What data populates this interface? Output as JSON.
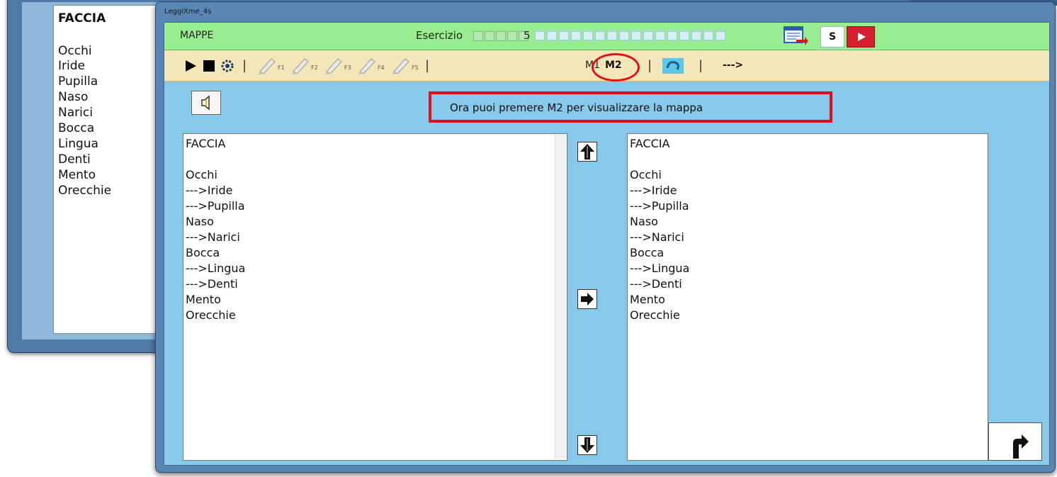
{
  "background_window": {
    "list": [
      "FACCIA",
      "",
      "Occhi",
      "Iride",
      "Pupilla",
      "Naso",
      "Narici",
      "Bocca",
      "Lingua",
      "Denti",
      "Mento",
      "Orecchie"
    ]
  },
  "window": {
    "title": "LeggiXme_4s",
    "topbar": {
      "section": "MAPPE",
      "exercise_label": "Esercizio",
      "exercise_number": "5",
      "s_button": "S"
    },
    "toolbar": {
      "separator": "|",
      "f_labels": [
        "F1",
        "F2",
        "F3",
        "F4",
        "F5"
      ],
      "m1": "M1",
      "m2": "M2",
      "next": "--->"
    },
    "message": "Ora puoi premere M2 per visualizzare la mappa",
    "left_list": [
      "FACCIA",
      "",
      "Occhi",
      "--->Iride",
      "--->Pupilla",
      "Naso",
      "--->Narici",
      "Bocca",
      "--->Lingua",
      "--->Denti",
      "Mento",
      "Orecchie"
    ],
    "right_list": [
      "FACCIA",
      "",
      "Occhi",
      "--->Iride",
      "--->Pupilla",
      "Naso",
      "--->Narici",
      "Bocca",
      "--->Lingua",
      "--->Denti",
      "Mento",
      "Orecchie"
    ]
  },
  "colors": {
    "topbar": "#98ee8e",
    "toolbar": "#f3e6b9",
    "panel": "#87c9ea",
    "highlight": "#e0101a"
  },
  "icons": [
    "play-icon",
    "stop-icon",
    "settings-icon",
    "pencil-icon",
    "speaker-icon",
    "arrow-up-icon",
    "arrow-right-icon",
    "arrow-down-icon",
    "return-arrow-icon",
    "exit-icon"
  ]
}
